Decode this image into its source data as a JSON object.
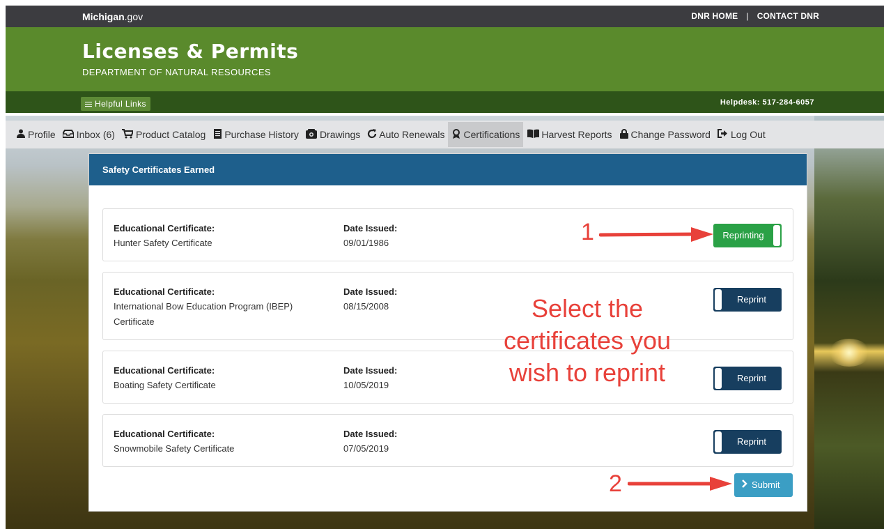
{
  "topbar": {
    "site_name_bold": "Michigan",
    "site_name_rest": ".gov",
    "link_home": "DNR HOME",
    "separator": "|",
    "link_contact": "CONTACT DNR"
  },
  "header": {
    "title": "Licenses & Permits",
    "subtitle": "DEPARTMENT OF NATURAL RESOURCES"
  },
  "strip": {
    "helpful_links": "Helpful Links",
    "helpdesk": "Helpdesk: 517-284-6057"
  },
  "nav": {
    "items": [
      {
        "label": "Profile",
        "icon": "user-icon"
      },
      {
        "label": "Inbox (6)",
        "icon": "inbox-icon"
      },
      {
        "label": "Product Catalog",
        "icon": "cart-icon"
      },
      {
        "label": "Purchase History",
        "icon": "document-icon"
      },
      {
        "label": "Drawings",
        "icon": "drawings-icon"
      },
      {
        "label": "Auto Renewals",
        "icon": "refresh-icon"
      },
      {
        "label": "Certifications",
        "icon": "ribbon-icon",
        "active": true
      },
      {
        "label": "Harvest Reports",
        "icon": "book-icon"
      },
      {
        "label": "Change Password",
        "icon": "lock-icon"
      },
      {
        "label": "Log Out",
        "icon": "logout-icon"
      }
    ]
  },
  "panel": {
    "title": "Safety Certificates Earned",
    "cert_label": "Educational Certificate:",
    "date_label": "Date Issued:",
    "certificates": [
      {
        "name": "Hunter Safety Certificate",
        "date": "09/01/1986",
        "toggle": "Reprinting",
        "selected": true
      },
      {
        "name_line1": "International Bow Education Program (IBEP)",
        "name_line2": "Certificate",
        "date": "08/15/2008",
        "toggle": "Reprint",
        "selected": false
      },
      {
        "name": "Boating Safety Certificate",
        "date": "10/05/2019",
        "toggle": "Reprint",
        "selected": false
      },
      {
        "name": "Snowmobile Safety Certificate",
        "date": "07/05/2019",
        "toggle": "Reprint",
        "selected": false
      }
    ],
    "submit": "Submit"
  },
  "annotations": {
    "num1": "1",
    "num2": "2",
    "text_line1": "Select the",
    "text_line2": "certificates you",
    "text_line3": "wish to reprint",
    "color": "#e8413a"
  },
  "colors": {
    "header_green": "#5a8a2c",
    "strip_green": "#2e5419",
    "panel_blue": "#1e5f8c",
    "toggle_on": "#2aa146",
    "toggle_off": "#173e5f",
    "submit": "#3b9ec4"
  }
}
